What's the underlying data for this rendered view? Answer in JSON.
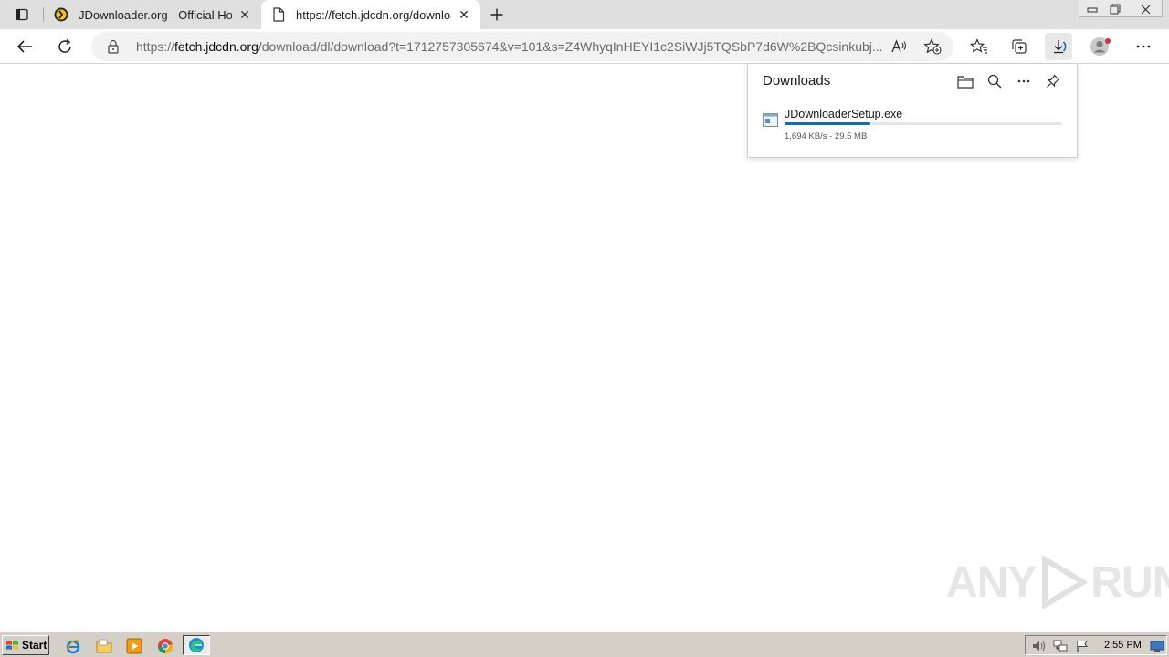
{
  "tabs": [
    {
      "title": "JDownloader.org - Official Homepage",
      "close": "✕"
    },
    {
      "title": "https://fetch.jdcdn.org/download/dl/download",
      "close": "✕"
    }
  ],
  "address": {
    "scheme": "https://",
    "host": "fetch.jdcdn.org",
    "path": "/download/dl/download?t=1712757305674&v=101&s=Z4WhyqInHEYI1c2SiWJj5TQSbP7d6W%2BQcsinkubj..."
  },
  "downloads": {
    "title": "Downloads",
    "items": [
      {
        "filename": "JDownloaderSetup.exe",
        "meta": "1,694 KB/s - 29.5 MB",
        "progress_percent": 31
      }
    ]
  },
  "watermark": {
    "left": "ANY",
    "right": "RUN"
  },
  "taskbar": {
    "start_label": "Start",
    "clock": "2:55 PM"
  },
  "colors": {
    "accent": "#0f6cbd",
    "tabstrip": "#dfdfdf",
    "taskbar": "#d4d0c8",
    "profile_badge": "#d13438"
  }
}
